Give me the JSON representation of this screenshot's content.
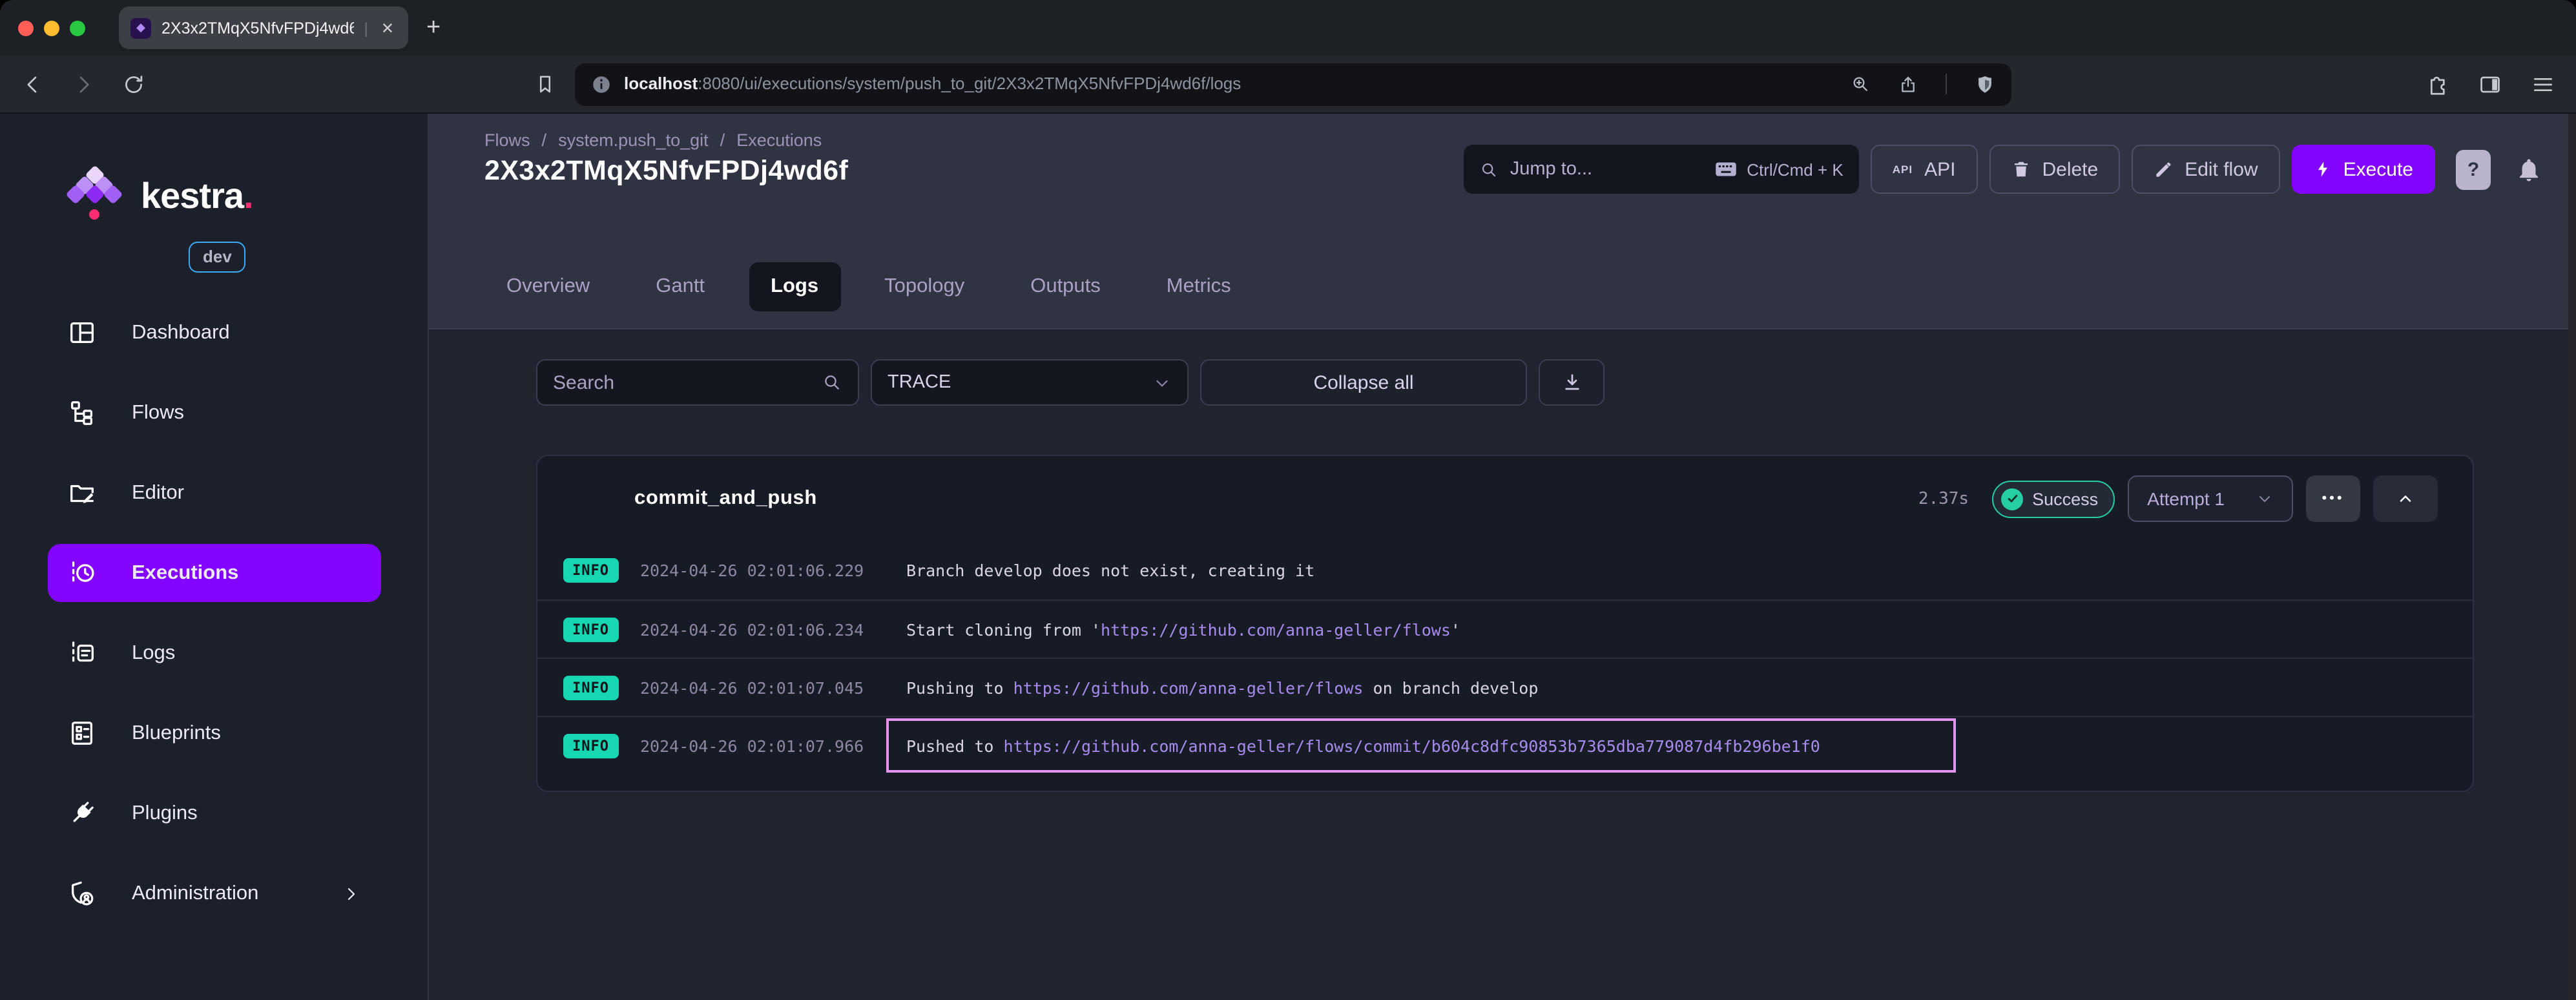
{
  "colors": {
    "accent": "#8405ff",
    "success": "#25cfa2",
    "info": "#17d6b2",
    "link": "#a78bee",
    "highlight": "#e494f0"
  },
  "glyphs": {
    "close": "✕",
    "plus": "+",
    "pipe": "|",
    "sep": "/",
    "favicon": "◆",
    "dots": "•••"
  },
  "browser": {
    "tab": {
      "title": "2X3x2TMqX5NfvFPDj4wd6f"
    },
    "url": {
      "host": "localhost",
      "path": ":8080/ui/executions/system/push_to_git/2X3x2TMqX5NfvFPDj4wd6f/logs"
    }
  },
  "sidebar": {
    "brand": "kestra",
    "brand_dot": ".",
    "env": "dev",
    "items": [
      {
        "label": "Dashboard"
      },
      {
        "label": "Flows"
      },
      {
        "label": "Editor"
      },
      {
        "label": "Executions"
      },
      {
        "label": "Logs"
      },
      {
        "label": "Blueprints"
      },
      {
        "label": "Plugins"
      },
      {
        "label": "Administration"
      }
    ]
  },
  "header": {
    "breadcrumb": {
      "items": [
        "Flows",
        "system.push_to_git",
        "Executions"
      ],
      "separator": "/"
    },
    "title": "2X3x2TMqX5NfvFPDj4wd6f",
    "jump_to": {
      "label": "Jump to...",
      "shortcut": "Ctrl/Cmd + K"
    },
    "api_icon": "API",
    "api": "API",
    "delete": "Delete",
    "edit_flow": "Edit flow",
    "execute": "Execute",
    "help": "?"
  },
  "tabs": [
    {
      "label": "Overview"
    },
    {
      "label": "Gantt"
    },
    {
      "label": "Logs"
    },
    {
      "label": "Topology"
    },
    {
      "label": "Outputs"
    },
    {
      "label": "Metrics"
    }
  ],
  "filters": {
    "search_placeholder": "Search",
    "level": "TRACE",
    "collapse_all": "Collapse all"
  },
  "task": {
    "name": "commit_and_push",
    "duration": "2.37s",
    "status": "Success",
    "attempt": "Attempt 1"
  },
  "logs": {
    "rows": [
      {
        "level": "INFO",
        "time": "2024-04-26 02:01:06.229",
        "parts": {
          "p0": "Branch develop does not exist, creating it"
        }
      },
      {
        "level": "INFO",
        "time": "2024-04-26 02:01:06.234",
        "parts": {
          "p0": "Start cloning from '",
          "link": "https://github.com/anna-geller/flows",
          "p1": "'"
        }
      },
      {
        "level": "INFO",
        "time": "2024-04-26 02:01:07.045",
        "parts": {
          "p0": "Pushing to ",
          "link": "https://github.com/anna-geller/flows",
          "p1": " on branch develop"
        }
      },
      {
        "level": "INFO",
        "time": "2024-04-26 02:01:07.966",
        "parts": {
          "p0": "Pushed to ",
          "link": "https://github.com/anna-geller/flows/commit/b604c8dfc90853b7365dba779087d4fb296be1f0"
        }
      }
    ]
  }
}
